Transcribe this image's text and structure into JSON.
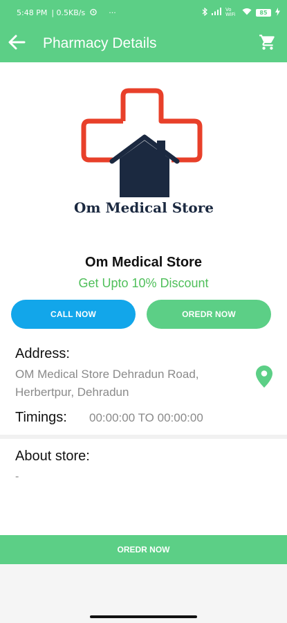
{
  "status_bar": {
    "time": "5:48 PM",
    "speed": "| 0.5KB/s",
    "more": "···",
    "network_label": "Vo WiFi",
    "battery": "85"
  },
  "app_bar": {
    "title": "Pharmacy Details",
    "back_icon": "arrow-left-icon",
    "cart_icon": "cart-icon"
  },
  "logo": {
    "text": "Om Medical Store",
    "cross_color": "#e8402a",
    "house_color": "#1b2940"
  },
  "store": {
    "name": "Om Medical Store",
    "discount": "Get Upto 10% Discount"
  },
  "actions": {
    "call_label": "CALL NOW",
    "order_label": "OREDR NOW"
  },
  "address": {
    "label": "Address:",
    "line1": "OM Medical Store Dehradun Road,",
    "line2": "Herbertpur, Dehradun",
    "pin_icon": "location-pin-icon"
  },
  "timings": {
    "label": "Timings:",
    "value": "00:00:00 TO 00:00:00"
  },
  "about": {
    "label": "About store:",
    "text": "-"
  },
  "bottom_bar": {
    "order_label": "OREDR NOW"
  },
  "colors": {
    "primary_green": "#5ccf86",
    "call_blue": "#12a6ea",
    "discount_green": "#4fbf5a"
  }
}
